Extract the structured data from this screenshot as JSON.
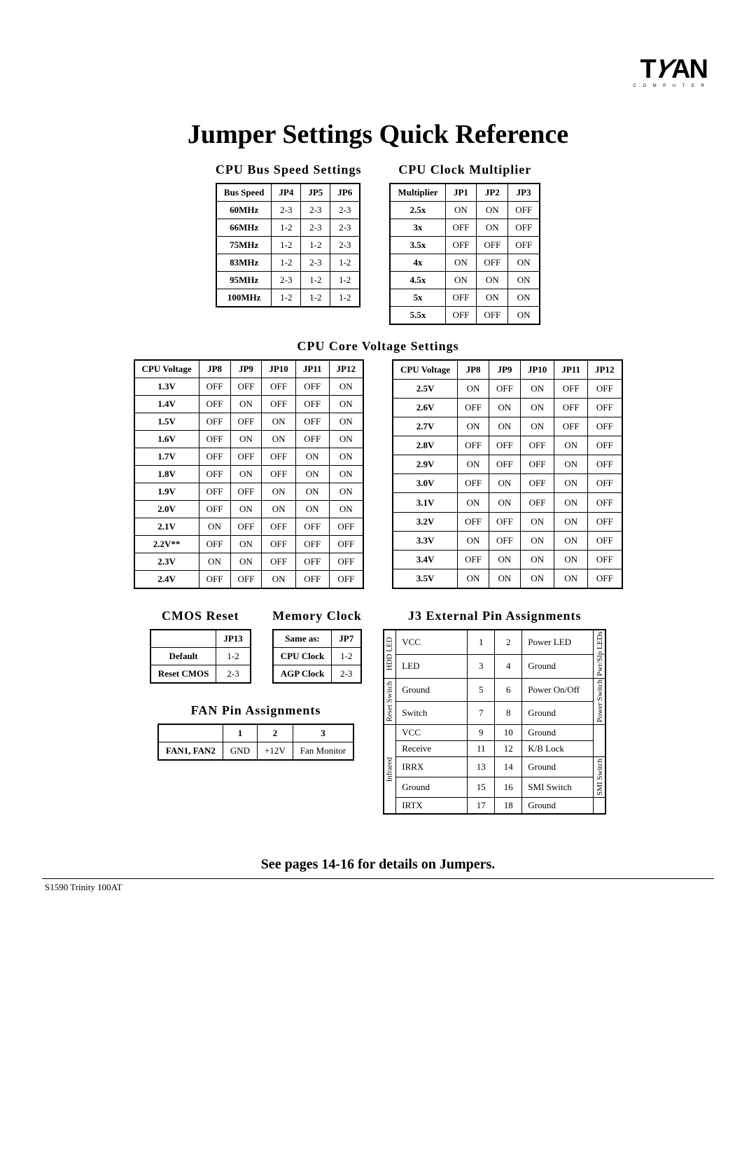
{
  "logo": {
    "main": "TYAN",
    "sub": "C O M P U T E R"
  },
  "title": "Jumper Settings Quick Reference",
  "bus_speed": {
    "title": "CPU Bus Speed Settings",
    "headers": [
      "Bus Speed",
      "JP4",
      "JP5",
      "JP6"
    ],
    "rows": [
      [
        "60MHz",
        "2-3",
        "2-3",
        "2-3"
      ],
      [
        "66MHz",
        "1-2",
        "2-3",
        "2-3"
      ],
      [
        "75MHz",
        "1-2",
        "1-2",
        "2-3"
      ],
      [
        "83MHz",
        "1-2",
        "2-3",
        "1-2"
      ],
      [
        "95MHz",
        "2-3",
        "1-2",
        "1-2"
      ],
      [
        "100MHz",
        "1-2",
        "1-2",
        "1-2"
      ]
    ]
  },
  "multiplier": {
    "title": "CPU Clock Multiplier",
    "headers": [
      "Multiplier",
      "JP1",
      "JP2",
      "JP3"
    ],
    "rows": [
      [
        "2.5x",
        "ON",
        "ON",
        "OFF"
      ],
      [
        "3x",
        "OFF",
        "ON",
        "OFF"
      ],
      [
        "3.5x",
        "OFF",
        "OFF",
        "OFF"
      ],
      [
        "4x",
        "ON",
        "OFF",
        "ON"
      ],
      [
        "4.5x",
        "ON",
        "ON",
        "ON"
      ],
      [
        "5x",
        "OFF",
        "ON",
        "ON"
      ],
      [
        "5.5x",
        "OFF",
        "OFF",
        "ON"
      ]
    ]
  },
  "voltage": {
    "title": "CPU Core Voltage Settings",
    "headers": [
      "CPU Voltage",
      "JP8",
      "JP9",
      "JP10",
      "JP11",
      "JP12"
    ],
    "left_rows": [
      [
        "1.3V",
        "OFF",
        "OFF",
        "OFF",
        "OFF",
        "ON"
      ],
      [
        "1.4V",
        "OFF",
        "ON",
        "OFF",
        "OFF",
        "ON"
      ],
      [
        "1.5V",
        "OFF",
        "OFF",
        "ON",
        "OFF",
        "ON"
      ],
      [
        "1.6V",
        "OFF",
        "ON",
        "ON",
        "OFF",
        "ON"
      ],
      [
        "1.7V",
        "OFF",
        "OFF",
        "OFF",
        "ON",
        "ON"
      ],
      [
        "1.8V",
        "OFF",
        "ON",
        "OFF",
        "ON",
        "ON"
      ],
      [
        "1.9V",
        "OFF",
        "OFF",
        "ON",
        "ON",
        "ON"
      ],
      [
        "2.0V",
        "OFF",
        "ON",
        "ON",
        "ON",
        "ON"
      ],
      [
        "2.1V",
        "ON",
        "OFF",
        "OFF",
        "OFF",
        "OFF"
      ],
      [
        "2.2V**",
        "OFF",
        "ON",
        "OFF",
        "OFF",
        "OFF"
      ],
      [
        "2.3V",
        "ON",
        "ON",
        "OFF",
        "OFF",
        "OFF"
      ],
      [
        "2.4V",
        "OFF",
        "OFF",
        "ON",
        "OFF",
        "OFF"
      ]
    ],
    "right_rows": [
      [
        "2.5V",
        "ON",
        "OFF",
        "ON",
        "OFF",
        "OFF"
      ],
      [
        "2.6V",
        "OFF",
        "ON",
        "ON",
        "OFF",
        "OFF"
      ],
      [
        "2.7V",
        "ON",
        "ON",
        "ON",
        "OFF",
        "OFF"
      ],
      [
        "2.8V",
        "OFF",
        "OFF",
        "OFF",
        "ON",
        "OFF"
      ],
      [
        "2.9V",
        "ON",
        "OFF",
        "OFF",
        "ON",
        "OFF"
      ],
      [
        "3.0V",
        "OFF",
        "ON",
        "OFF",
        "ON",
        "OFF"
      ],
      [
        "3.1V",
        "ON",
        "ON",
        "OFF",
        "ON",
        "OFF"
      ],
      [
        "3.2V",
        "OFF",
        "OFF",
        "ON",
        "ON",
        "OFF"
      ],
      [
        "3.3V",
        "ON",
        "OFF",
        "ON",
        "ON",
        "OFF"
      ],
      [
        "3.4V",
        "OFF",
        "ON",
        "ON",
        "ON",
        "OFF"
      ],
      [
        "3.5V",
        "ON",
        "ON",
        "ON",
        "ON",
        "OFF"
      ]
    ]
  },
  "cmos": {
    "title": "CMOS Reset",
    "headers": [
      "",
      "JP13"
    ],
    "rows": [
      [
        "Default",
        "1-2"
      ],
      [
        "Reset CMOS",
        "2-3"
      ]
    ]
  },
  "memclk": {
    "title": "Memory Clock",
    "headers": [
      "Same as:",
      "JP7"
    ],
    "rows": [
      [
        "CPU Clock",
        "1-2"
      ],
      [
        "AGP Clock",
        "2-3"
      ]
    ]
  },
  "fan": {
    "title": "FAN Pin Assignments",
    "headers": [
      "",
      "1",
      "2",
      "3"
    ],
    "rows": [
      [
        "FAN1, FAN2",
        "GND",
        "+12V",
        "Fan Monitor"
      ]
    ]
  },
  "j3": {
    "title": "J3 External Pin Assignments",
    "left_groups": [
      "HDD LED",
      "Reset Switch",
      "Infrared"
    ],
    "right_groups": [
      "Pwr/Slp LEDs",
      "Power Switch",
      "",
      "SMI Switch",
      ""
    ],
    "rows": [
      [
        "VCC",
        "1",
        "2",
        "Power LED"
      ],
      [
        "LED",
        "3",
        "4",
        "Ground"
      ],
      [
        "Ground",
        "5",
        "6",
        "Power On/Off"
      ],
      [
        "Switch",
        "7",
        "8",
        "Ground"
      ],
      [
        "VCC",
        "9",
        "10",
        "Ground"
      ],
      [
        "Receive",
        "11",
        "12",
        "K/B Lock"
      ],
      [
        "IRRX",
        "13",
        "14",
        "Ground"
      ],
      [
        "Ground",
        "15",
        "16",
        "SMI Switch"
      ],
      [
        "IRTX",
        "17",
        "18",
        "Ground"
      ]
    ]
  },
  "footer_note": "See pages 14-16 for details on Jumpers.",
  "model": "S1590 Trinity 100AT"
}
